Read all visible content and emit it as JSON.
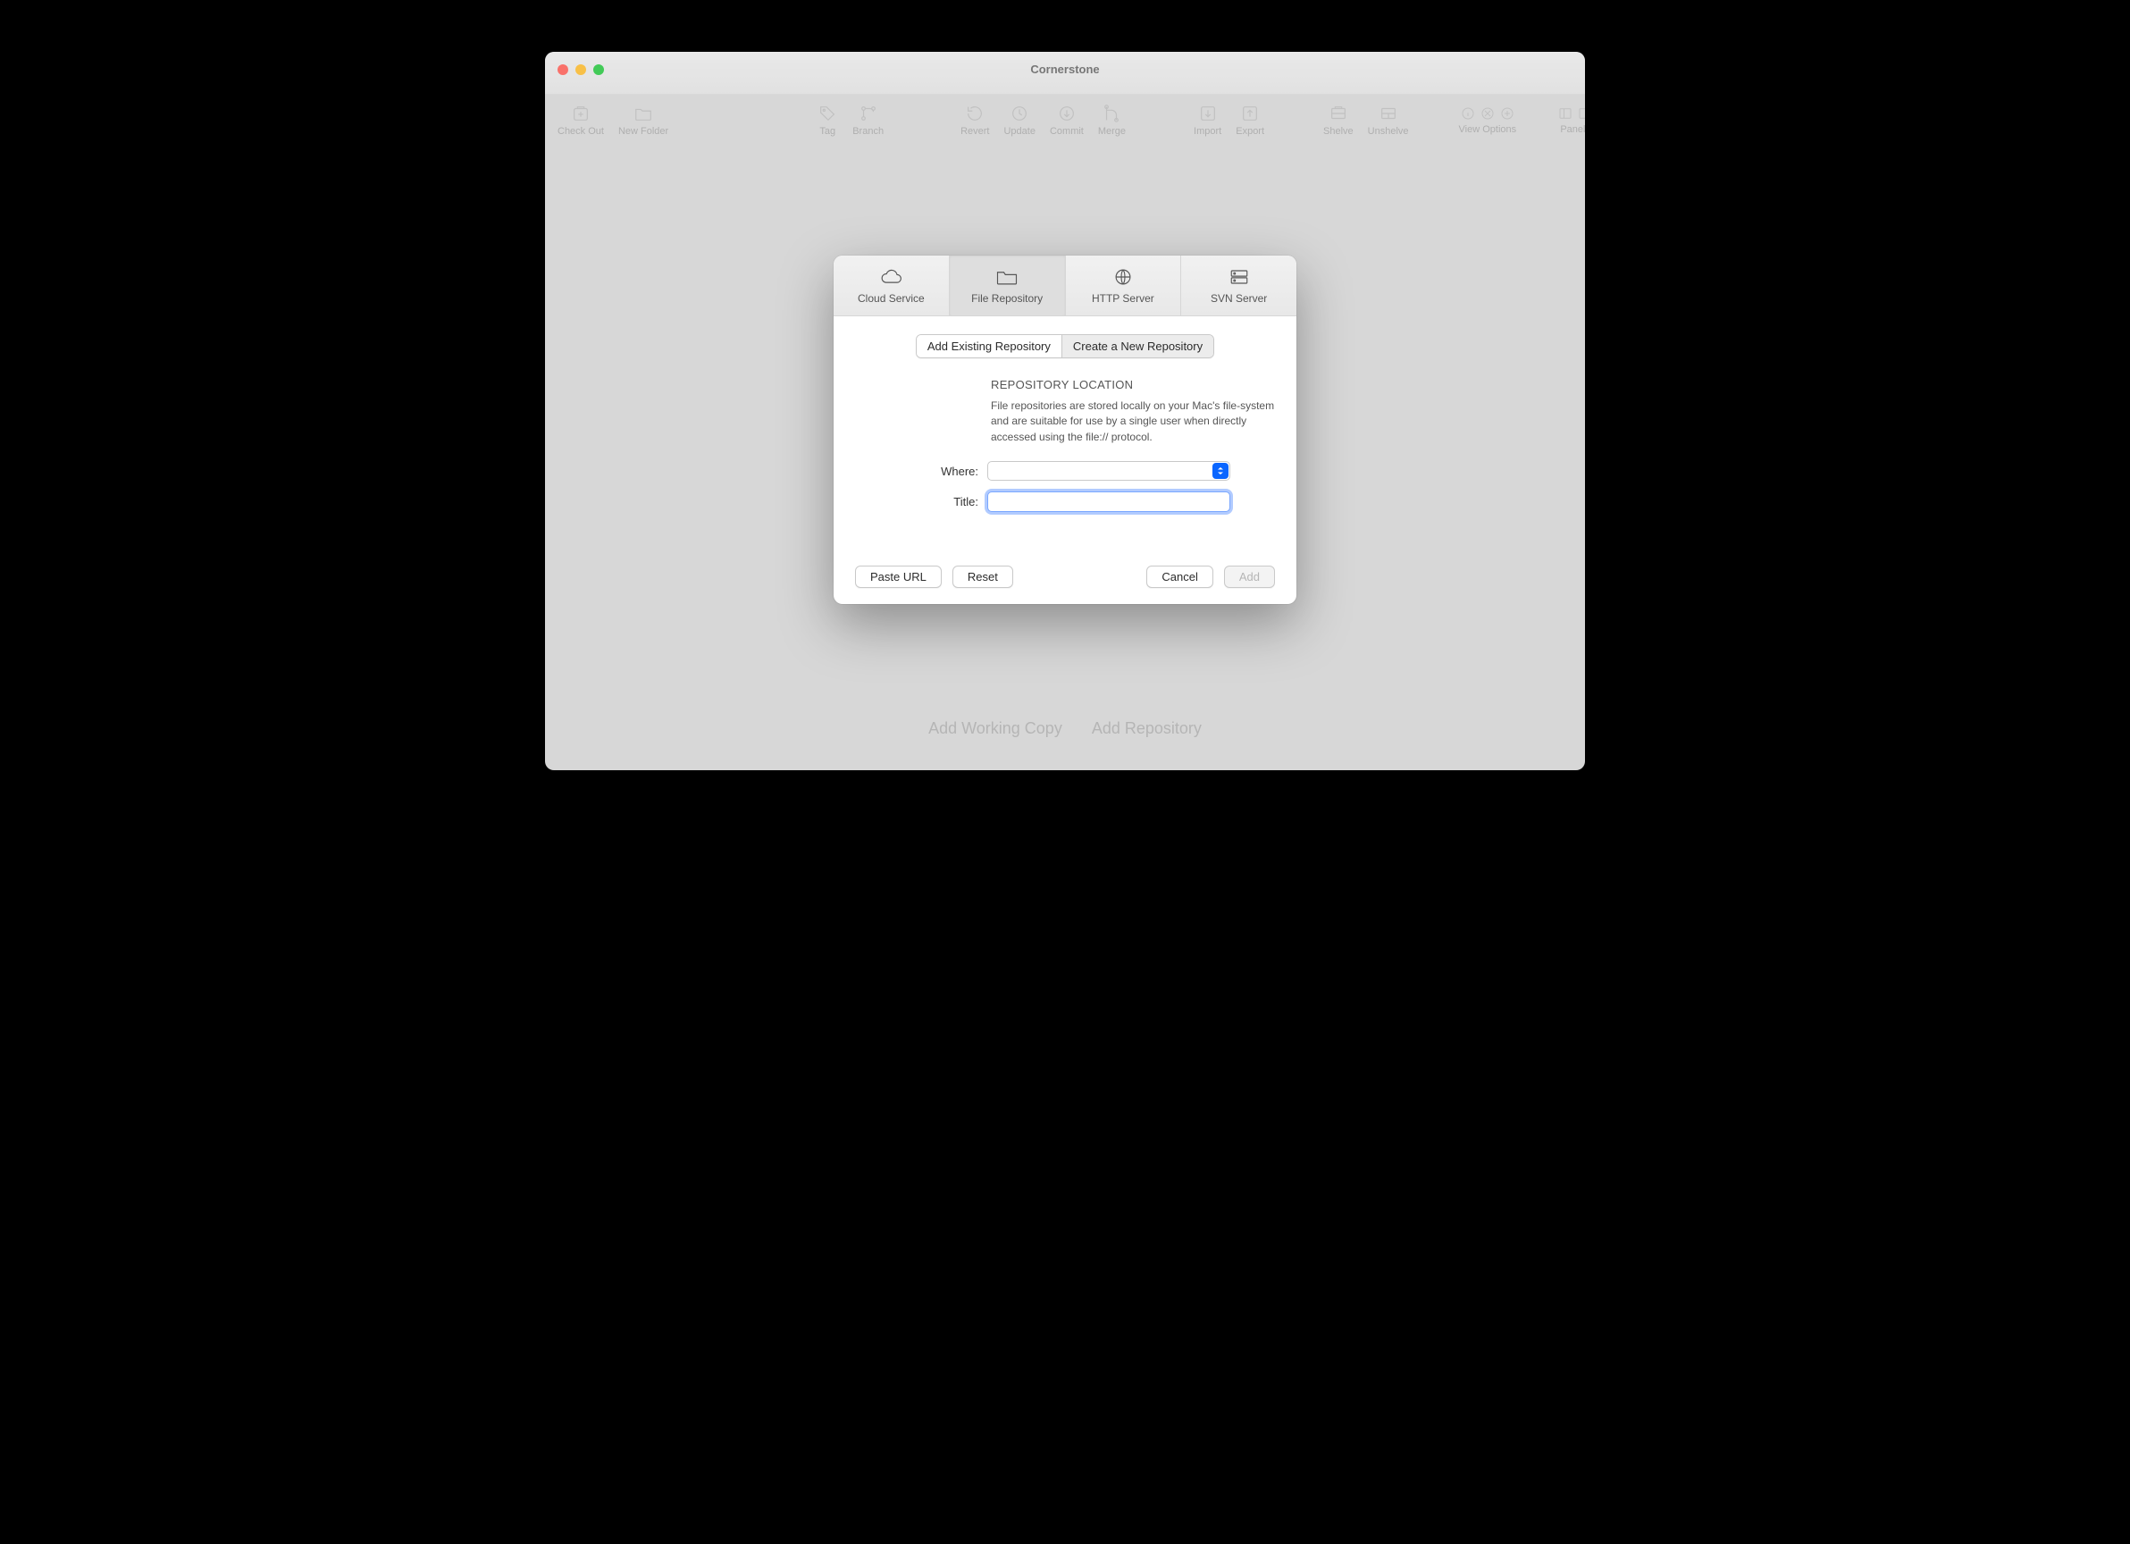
{
  "app": {
    "title": "Cornerstone"
  },
  "toolbar": {
    "items": [
      {
        "label": "Check Out"
      },
      {
        "label": "New Folder"
      },
      {
        "label": "Tag"
      },
      {
        "label": "Branch"
      },
      {
        "label": "Revert"
      },
      {
        "label": "Update"
      },
      {
        "label": "Commit"
      },
      {
        "label": "Merge"
      },
      {
        "label": "Import"
      },
      {
        "label": "Export"
      },
      {
        "label": "Shelve"
      },
      {
        "label": "Unshelve"
      },
      {
        "label": "View Options"
      },
      {
        "label": "Panels"
      }
    ]
  },
  "empty_state": {
    "add_working_copy": "Add Working Copy",
    "add_repository": "Add Repository"
  },
  "sheet": {
    "tabs": {
      "cloud": "Cloud Service",
      "file": "File Repository",
      "http": "HTTP Server",
      "svn": "SVN Server"
    },
    "segmented": {
      "existing": "Add Existing Repository",
      "create": "Create a New Repository"
    },
    "section_title": "REPOSITORY LOCATION",
    "info_text": "File repositories are stored locally on your Mac's file-system and are suitable for use by a single user when directly accessed using the file:// protocol.",
    "labels": {
      "where": "Where:",
      "title": "Title:"
    },
    "fields": {
      "where_value": "",
      "title_value": ""
    },
    "buttons": {
      "paste_url": "Paste URL",
      "reset": "Reset",
      "cancel": "Cancel",
      "add": "Add"
    }
  }
}
